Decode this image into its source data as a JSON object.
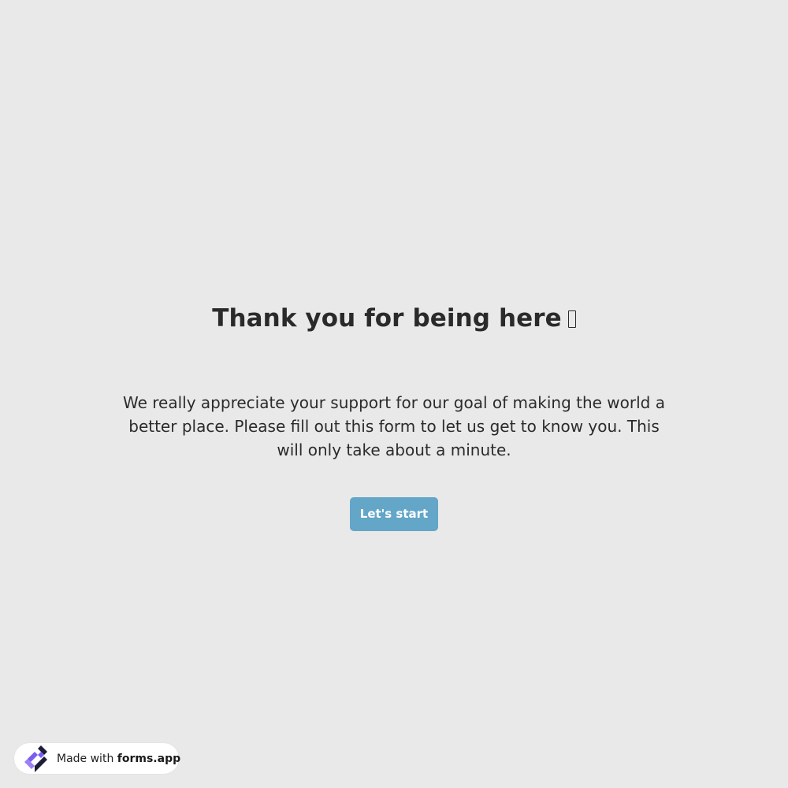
{
  "welcome": {
    "title": "Thank you for being here",
    "description": "We really appreciate your support for our goal of making the world a better place. Please fill out this form to let us get to know you. This will only take about a minute.",
    "start_button": "Let's start"
  },
  "badge": {
    "prefix": "Made with",
    "brand": "forms.app",
    "logo_icon": "forms-app-logo-icon"
  },
  "colors": {
    "background": "#e9e9e9",
    "button": "#63a6c8",
    "logo_purple": "#7b5cf0",
    "logo_dark": "#1d1d3a"
  }
}
